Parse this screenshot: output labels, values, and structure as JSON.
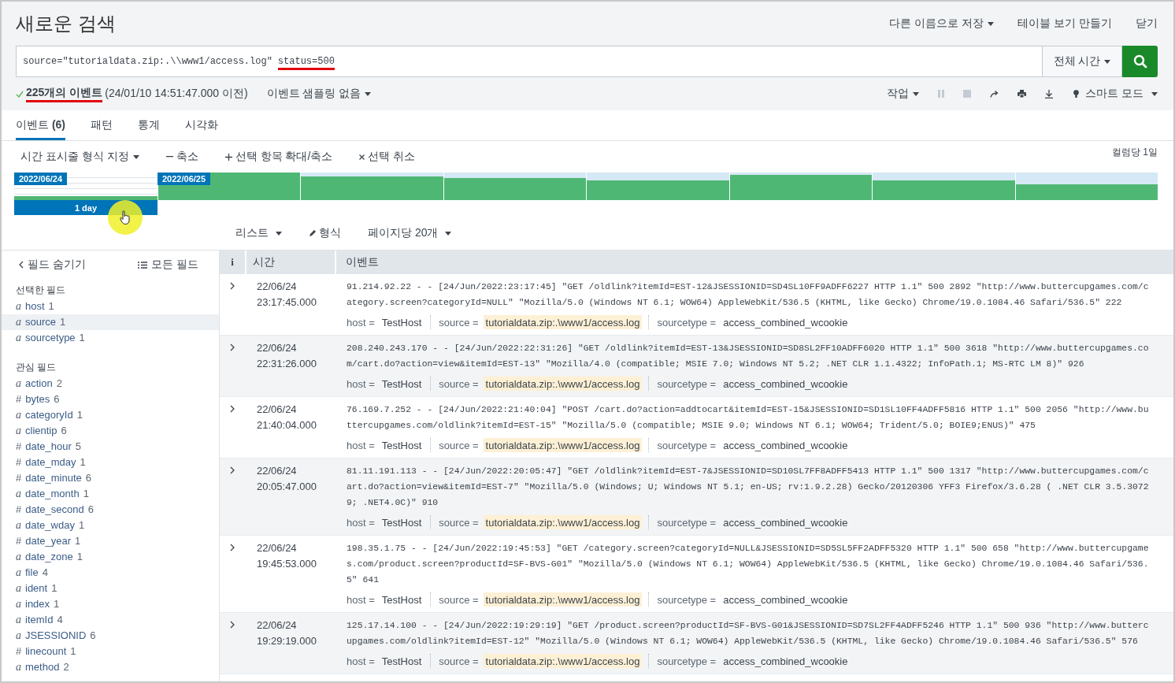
{
  "header": {
    "title": "새로운 검색",
    "actions": [
      {
        "label": "다른 이름으로 저장",
        "dropdown": true
      },
      {
        "label": "테이블 보기 만들기",
        "dropdown": false
      },
      {
        "label": "닫기",
        "dropdown": false
      }
    ]
  },
  "search": {
    "query_parts": [
      {
        "text": "source=\"tutorialdata.zip:.\\\\www1/access.log\"",
        "underlined": false
      },
      {
        "text": "status=500",
        "underlined": true
      }
    ],
    "time_range": "전체 시간"
  },
  "status": {
    "count": "225개의 이벤트",
    "count_underlined": true,
    "range": "(24/01/10 14:51:47.000 이전)",
    "sampling": "이벤트 샘플링 없음",
    "job": "작업",
    "mode": "스마트 모드"
  },
  "tabs": [
    {
      "label": "이벤트 **(6)**",
      "selected": true
    },
    {
      "label": "패턴",
      "selected": false
    },
    {
      "label": "통계",
      "selected": false
    },
    {
      "label": "시각화",
      "selected": false
    }
  ],
  "timeline": {
    "format": "시간 표시줄 형식 지정",
    "zoom_out": "축소",
    "zoom_selection": "선택 항목 확대/축소",
    "deselect": "선택 취소",
    "scale": "컬럼당 1일",
    "labels": [
      "2022/06/24",
      "2022/06/25"
    ],
    "selection": "1 day"
  },
  "list_controls": {
    "view": "리스트",
    "format": "형식",
    "per_page": "페이지당 20개"
  },
  "sidebar": {
    "hide": "필드 숨기기",
    "all": "모든 필드",
    "groups": [
      {
        "title": "선택한 필드",
        "fields": [
          {
            "type": "a",
            "name": "host",
            "count": "1",
            "highlighted": false
          },
          {
            "type": "a",
            "name": "source",
            "count": "1",
            "highlighted": true
          },
          {
            "type": "a",
            "name": "sourcetype",
            "count": "1",
            "highlighted": false
          }
        ]
      },
      {
        "title": "관심 필드",
        "fields": [
          {
            "type": "a",
            "name": "action",
            "count": "2",
            "highlighted": false
          },
          {
            "type": "#",
            "name": "bytes",
            "count": "6",
            "highlighted": false
          },
          {
            "type": "a",
            "name": "categoryId",
            "count": "1",
            "highlighted": false
          },
          {
            "type": "a",
            "name": "clientip",
            "count": "6",
            "highlighted": false
          },
          {
            "type": "#",
            "name": "date_hour",
            "count": "5",
            "highlighted": false
          },
          {
            "type": "#",
            "name": "date_mday",
            "count": "1",
            "highlighted": false
          },
          {
            "type": "#",
            "name": "date_minute",
            "count": "6",
            "highlighted": false
          },
          {
            "type": "a",
            "name": "date_month",
            "count": "1",
            "highlighted": false
          },
          {
            "type": "#",
            "name": "date_second",
            "count": "6",
            "highlighted": false
          },
          {
            "type": "a",
            "name": "date_wday",
            "count": "1",
            "highlighted": false
          },
          {
            "type": "#",
            "name": "date_year",
            "count": "1",
            "highlighted": false
          },
          {
            "type": "a",
            "name": "date_zone",
            "count": "1",
            "highlighted": false
          },
          {
            "type": "a",
            "name": "file",
            "count": "4",
            "highlighted": false
          },
          {
            "type": "a",
            "name": "ident",
            "count": "1",
            "highlighted": false
          },
          {
            "type": "a",
            "name": "index",
            "count": "1",
            "highlighted": false
          },
          {
            "type": "a",
            "name": "itemId",
            "count": "4",
            "highlighted": false
          },
          {
            "type": "a",
            "name": "JSESSIONID",
            "count": "6",
            "highlighted": false
          },
          {
            "type": "#",
            "name": "linecount",
            "count": "1",
            "highlighted": false
          },
          {
            "type": "a",
            "name": "method",
            "count": "2",
            "highlighted": false
          }
        ]
      }
    ]
  },
  "table": {
    "columns": [
      "i",
      "시간",
      "이벤트"
    ],
    "assign": "=",
    "rows": [
      {
        "date": "22/06/24",
        "time": "23:17:45.000",
        "lines": [
          "91.214.92.22 - - [24/Jun/2022:23:17:45] \"GET /oldlink?itemId=EST-12&JSESSIONID=SD4SL10FF9ADFF6227 HTTP 1.1\" 500 2892 \"http://www.buttercupgames.com/c",
          "ategory.screen?categoryId=NULL\" \"Mozilla/5.0 (Windows NT 6.1; WOW64) AppleWebKit/536.5 (KHTML, like Gecko) Chrome/19.0.1084.46 Safari/536.5\" 222"
        ],
        "fields": [
          {
            "key": "host",
            "value": "TestHost",
            "highlighted": false
          },
          {
            "key": "source",
            "value": "tutorialdata.zip:.\\www1/access.log",
            "highlighted": true
          },
          {
            "key": "sourcetype",
            "value": "access_combined_wcookie",
            "highlighted": false
          }
        ]
      },
      {
        "date": "22/06/24",
        "time": "22:31:26.000",
        "lines": [
          "208.240.243.170 - - [24/Jun/2022:22:31:26] \"GET /oldlink?itemId=EST-13&JSESSIONID=SD8SL2FF10ADFF6020 HTTP 1.1\" 500 3618 \"http://www.buttercupgames.co",
          "m/cart.do?action=view&itemId=EST-13\" \"Mozilla/4.0 (compatible; MSIE 7.0; Windows NT 5.2; .NET CLR 1.1.4322; InfoPath.1; MS-RTC LM 8)\" 926"
        ],
        "fields": [
          {
            "key": "host",
            "value": "TestHost",
            "highlighted": false
          },
          {
            "key": "source",
            "value": "tutorialdata.zip:.\\www1/access.log",
            "highlighted": true
          },
          {
            "key": "sourcetype",
            "value": "access_combined_wcookie",
            "highlighted": false
          }
        ]
      },
      {
        "date": "22/06/24",
        "time": "21:40:04.000",
        "lines": [
          "76.169.7.252 - - [24/Jun/2022:21:40:04] \"POST /cart.do?action=addtocart&itemId=EST-15&JSESSIONID=SD1SL10FF4ADFF5816 HTTP 1.1\" 500 2056 \"http://www.bu",
          "ttercupgames.com/oldlink?itemId=EST-15\" \"Mozilla/5.0 (compatible; MSIE 9.0; Windows NT 6.1; WOW64; Trident/5.0; BOIE9;ENUS)\" 475"
        ],
        "fields": [
          {
            "key": "host",
            "value": "TestHost",
            "highlighted": false
          },
          {
            "key": "source",
            "value": "tutorialdata.zip:.\\www1/access.log",
            "highlighted": true
          },
          {
            "key": "sourcetype",
            "value": "access_combined_wcookie",
            "highlighted": false
          }
        ]
      },
      {
        "date": "22/06/24",
        "time": "20:05:47.000",
        "lines": [
          "81.11.191.113 - - [24/Jun/2022:20:05:47] \"GET /oldlink?itemId=EST-7&JSESSIONID=SD10SL7FF8ADFF5413 HTTP 1.1\" 500 1317 \"http://www.buttercupgames.com/c",
          "art.do?action=view&itemId=EST-7\" \"Mozilla/5.0 (Windows; U; Windows NT 5.1; en-US; rv:1.9.2.28) Gecko/20120306 YFF3 Firefox/3.6.28 ( .NET CLR 3.5.3072",
          "9; .NET4.0C)\" 910"
        ],
        "fields": [
          {
            "key": "host",
            "value": "TestHost",
            "highlighted": false
          },
          {
            "key": "source",
            "value": "tutorialdata.zip:.\\www1/access.log",
            "highlighted": true
          },
          {
            "key": "sourcetype",
            "value": "access_combined_wcookie",
            "highlighted": false
          }
        ]
      },
      {
        "date": "22/06/24",
        "time": "19:45:53.000",
        "lines": [
          "198.35.1.75 - - [24/Jun/2022:19:45:53] \"GET /category.screen?categoryId=NULL&JSESSIONID=SD5SL5FF2ADFF5320 HTTP 1.1\" 500 658 \"http://www.buttercupgame",
          "s.com/product.screen?productId=SF-BVS-G01\" \"Mozilla/5.0 (Windows NT 6.1; WOW64) AppleWebKit/536.5 (KHTML, like Gecko) Chrome/19.0.1084.46 Safari/536.",
          "5\" 641"
        ],
        "fields": [
          {
            "key": "host",
            "value": "TestHost",
            "highlighted": false
          },
          {
            "key": "source",
            "value": "tutorialdata.zip:.\\www1/access.log",
            "highlighted": true
          },
          {
            "key": "sourcetype",
            "value": "access_combined_wcookie",
            "highlighted": false
          }
        ]
      },
      {
        "date": "22/06/24",
        "time": "19:29:19.000",
        "lines": [
          "125.17.14.100 - - [24/Jun/2022:19:29:19] \"GET /product.screen?productId=SF-BVS-G01&JSESSIONID=SD7SL2FF4ADFF5246 HTTP 1.1\" 500 936 \"http://www.butterc",
          "upgames.com/oldlink?itemId=EST-12\" \"Mozilla/5.0 (Windows NT 6.1; WOW64) AppleWebKit/536.5 (KHTML, like Gecko) Chrome/19.0.1084.46 Safari/536.5\" 576"
        ],
        "fields": [
          {
            "key": "host",
            "value": "TestHost",
            "highlighted": false
          },
          {
            "key": "source",
            "value": "tutorialdata.zip:.\\www1/access.log",
            "highlighted": true
          },
          {
            "key": "sourcetype",
            "value": "access_combined_wcookie",
            "highlighted": false
          }
        ]
      }
    ]
  }
}
